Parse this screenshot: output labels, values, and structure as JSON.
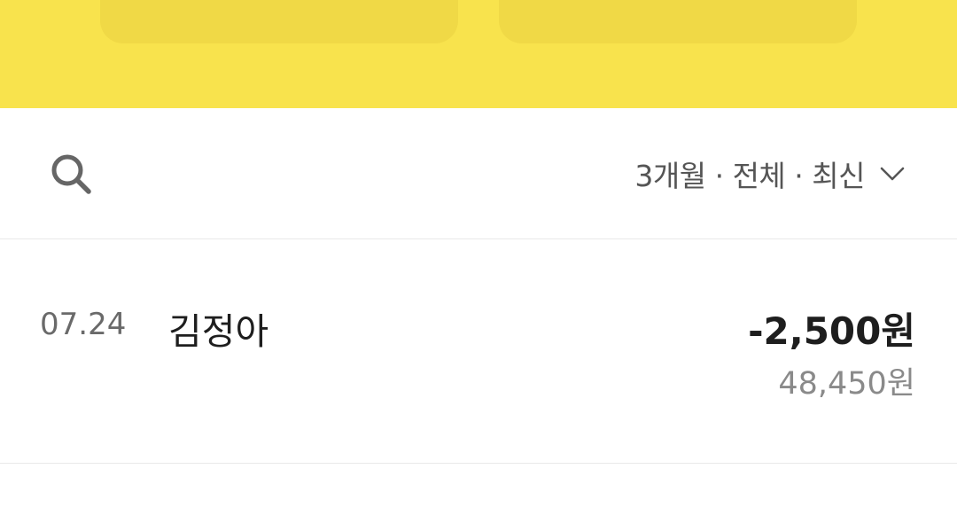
{
  "colors": {
    "header_yellow": "#f8e34d",
    "header_card": "#f0d946",
    "text_primary": "#1e1e1e",
    "text_secondary": "#8a8a8a"
  },
  "filter_bar": {
    "search_icon": "search-icon",
    "label": "3개월 · 전체 · 최신",
    "chevron_icon": "chevron-down-icon"
  },
  "transactions": [
    {
      "date": "07.24",
      "name": "김정아",
      "amount": "-2,500원",
      "balance": "48,450원"
    }
  ]
}
